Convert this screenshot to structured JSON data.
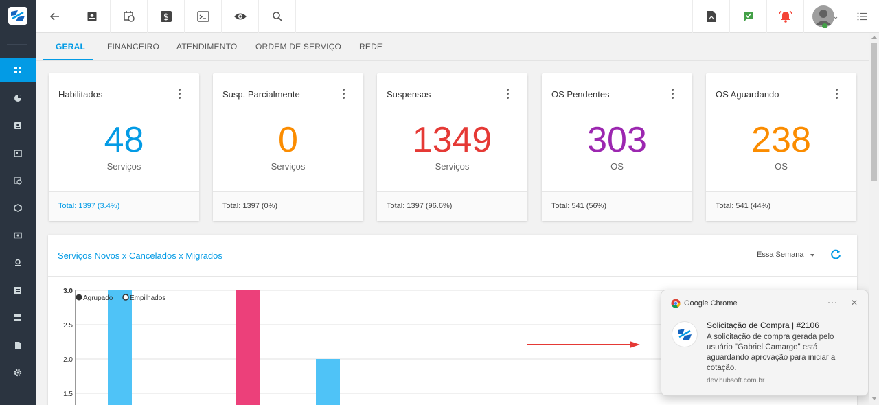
{
  "tabs": [
    "GERAL",
    "FINANCEIRO",
    "ATENDIMENTO",
    "ORDEM DE SERVIÇO",
    "REDE"
  ],
  "cards": [
    {
      "title": "Habilitados",
      "value": "48",
      "unit": "Serviços",
      "footer": "Total: 1397 (3.4%)",
      "color": "#039be5"
    },
    {
      "title": "Susp. Parcialmente",
      "value": "0",
      "unit": "Serviços",
      "footer": "Total:  1397 (0%)",
      "color": "#fb8c00"
    },
    {
      "title": "Suspensos",
      "value": "1349",
      "unit": "Serviços",
      "footer": "Total:  1397 (96.6%)",
      "color": "#e53935"
    },
    {
      "title": "OS Pendentes",
      "value": "303",
      "unit": "OS",
      "footer": "Total:  541 (56%)",
      "color": "#9c27b0"
    },
    {
      "title": "OS Aguardando",
      "value": "238",
      "unit": "OS",
      "footer": "Total:  541 (44%)",
      "color": "#fb8c00"
    }
  ],
  "panel": {
    "title": "Serviços Novos x Cancelados x Migrados",
    "period": "Essa Semana"
  },
  "chart_data": {
    "type": "bar",
    "legend": [
      "Agrupado",
      "Empilhados"
    ],
    "ytick_labels": [
      "3.0",
      "2.5",
      "2.0",
      "1.5"
    ],
    "ylim": [
      1.35,
      3.0
    ],
    "bars": [
      {
        "value": 3.0,
        "color": "#4fc3f7"
      },
      {
        "value": 3.0,
        "color": "#ec407a"
      },
      {
        "value": 2.0,
        "color": "#4fc3f7"
      }
    ]
  },
  "notification": {
    "app": "Google Chrome",
    "more": "···",
    "close": "✕",
    "title": "Solicitação de Compra | #2106",
    "body": "A solicitação de compra gerada pelo usuário \"Gabriel Camargo\" está aguardando aprovação para iniciar a cotação.",
    "site": "dev.hubsoft.com.br"
  },
  "topbar_icons": [
    "back-arrow-icon",
    "contact-card-icon",
    "calendar-clock-icon",
    "dollar-icon",
    "terminal-icon",
    "eye-icon",
    "search-icon",
    "pdf-icon",
    "chat-check-icon",
    "alarm-bell-icon",
    "user-avatar-icon",
    "list-menu-icon"
  ],
  "colors": {
    "accent": "#039be5",
    "sidebar": "#2b3440",
    "chat_badge": "#43a047",
    "bell": "#f44336",
    "arrow": "#e53935"
  }
}
